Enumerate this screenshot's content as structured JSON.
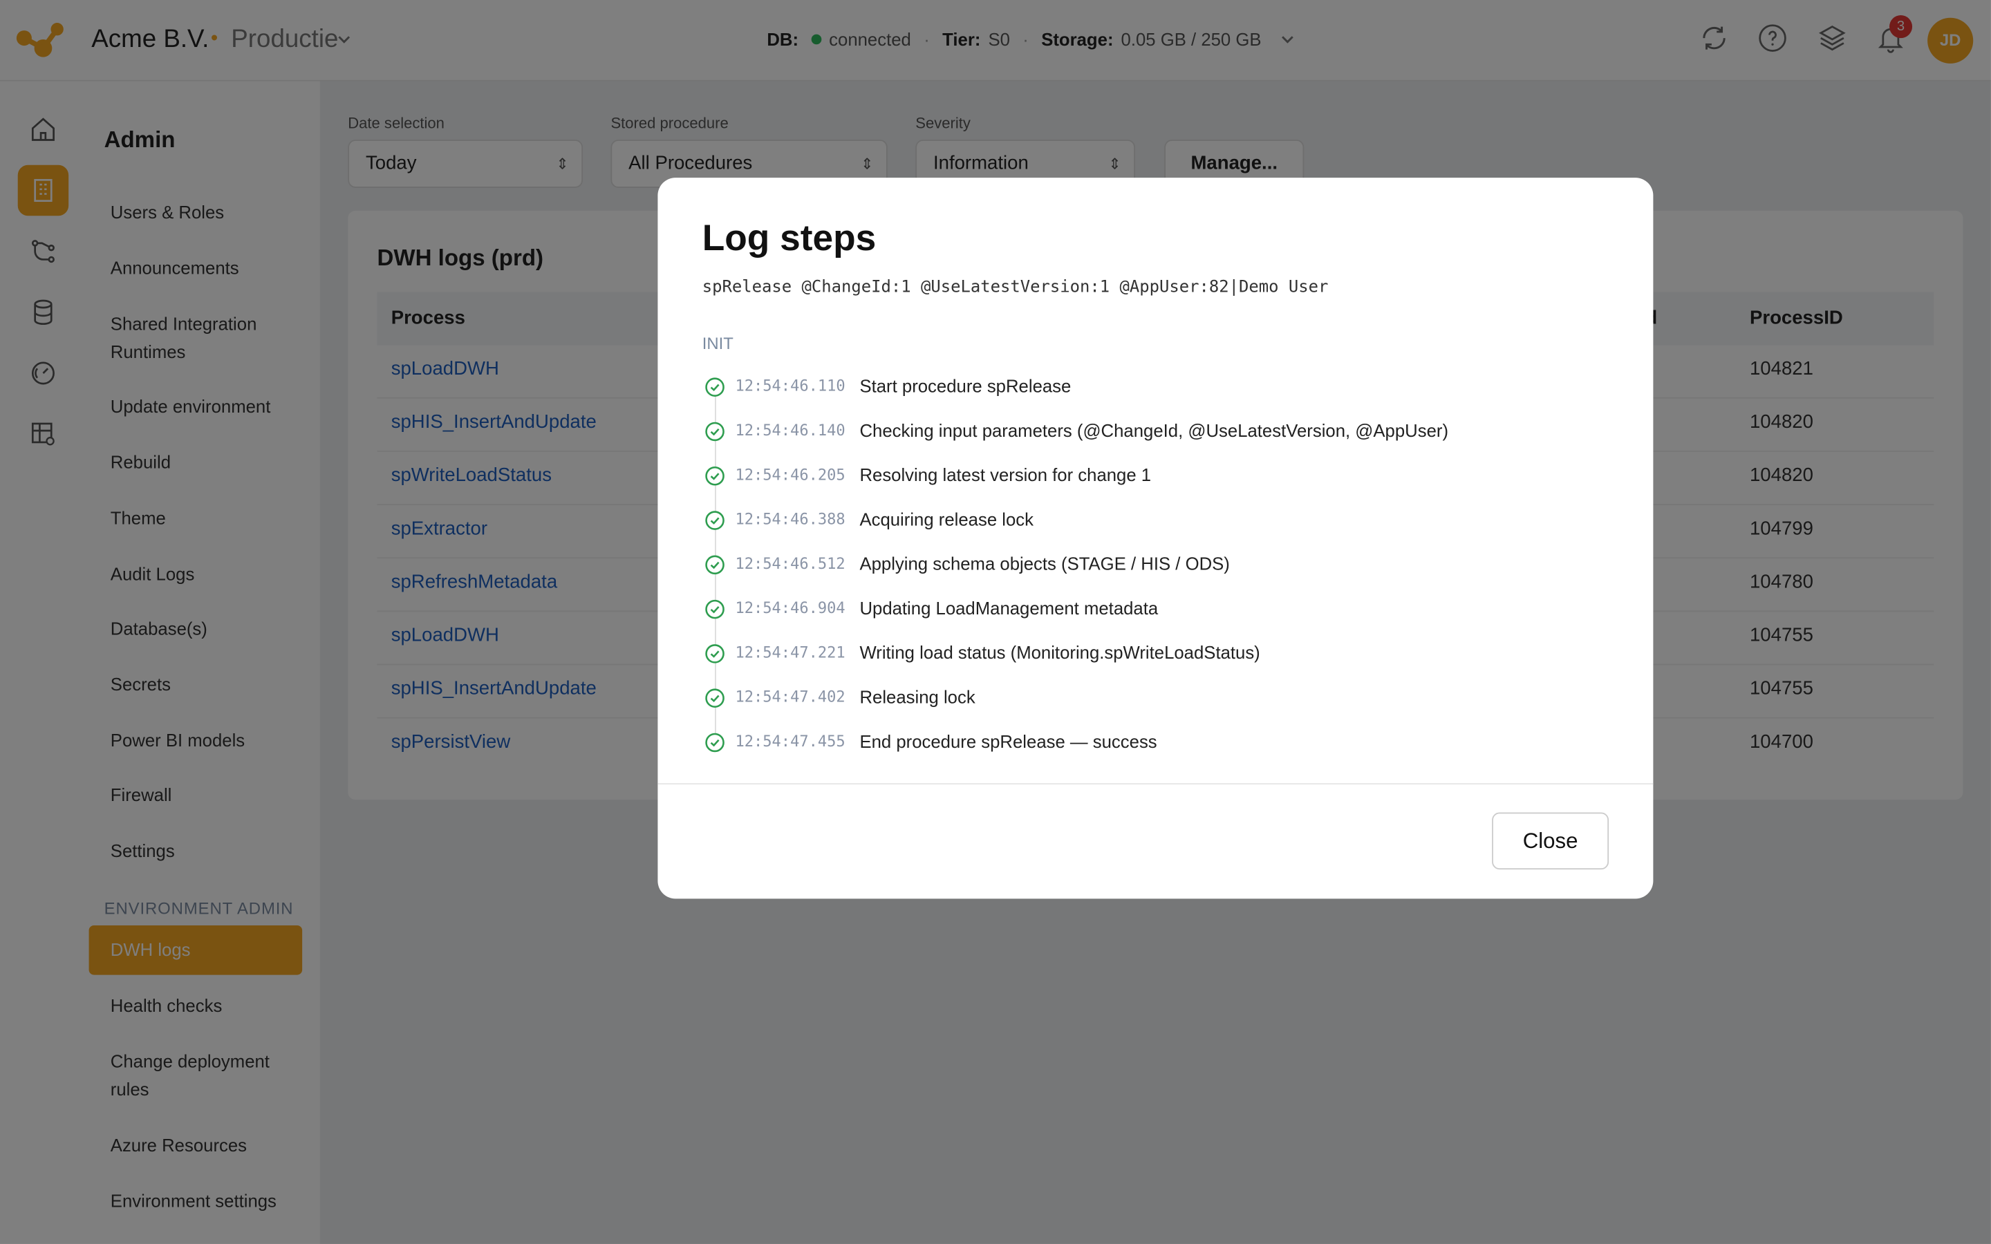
{
  "header": {
    "company": "Acme B.V.",
    "environment": "Productie",
    "db_label": "DB:",
    "db_value": "connected",
    "tier_label": "Tier:",
    "tier_value": "S0",
    "storage_label": "Storage:",
    "storage_value": "0.05 GB / 250 GB",
    "notifications_count": "3",
    "user_initials": "JD",
    "accent_color": "#f5a623"
  },
  "sidebar": {
    "title": "Admin",
    "items": [
      "Users & Roles",
      "Announcements",
      "Shared Integration Runtimes",
      "Update environment",
      "Rebuild",
      "Theme",
      "Audit Logs",
      "Database(s)",
      "Secrets",
      "Power BI models",
      "Firewall",
      "Settings"
    ],
    "section_label": "ENVIRONMENT ADMIN",
    "section_items": [
      "DWH logs",
      "Health checks",
      "Change deployment rules",
      "Azure Resources",
      "Environment settings"
    ],
    "active_item": "DWH logs"
  },
  "filters": {
    "date_label": "Date selection",
    "date_value": "Today",
    "proc_label": "Stored procedure",
    "proc_value": "All Procedures",
    "severity_label": "Severity",
    "severity_value": "Information",
    "manage_label": "Manage..."
  },
  "logs": {
    "title": "DWH logs (prd)",
    "col_process": "Process",
    "col_partial": "d",
    "col_pid": "ProcessID",
    "rows": [
      {
        "process": "spLoadDWH",
        "pid": "104821"
      },
      {
        "process": "spHIS_InsertAndUpdate",
        "pid": "104820"
      },
      {
        "process": "spWriteLoadStatus",
        "pid": "104820"
      },
      {
        "process": "spExtractor",
        "pid": "104799"
      },
      {
        "process": "spRefreshMetadata",
        "pid": "104780"
      },
      {
        "process": "spLoadDWH",
        "pid": "104755"
      },
      {
        "process": "spHIS_InsertAndUpdate",
        "pid": "104755"
      },
      {
        "process": "spPersistView",
        "pid": "104700"
      }
    ]
  },
  "modal": {
    "title": "Log steps",
    "command": "spRelease @ChangeId:1 @UseLatestVersion:1 @AppUser:82|Demo User",
    "section": "INIT",
    "steps": [
      {
        "ts": "12:54:46.110",
        "text": "Start procedure spRelease"
      },
      {
        "ts": "12:54:46.140",
        "text": "Checking input parameters (@ChangeId, @UseLatestVersion, @AppUser)"
      },
      {
        "ts": "12:54:46.205",
        "text": "Resolving latest version for change 1"
      },
      {
        "ts": "12:54:46.388",
        "text": "Acquiring release lock"
      },
      {
        "ts": "12:54:46.512",
        "text": "Applying schema objects (STAGE / HIS / ODS)"
      },
      {
        "ts": "12:54:46.904",
        "text": "Updating LoadManagement metadata"
      },
      {
        "ts": "12:54:47.221",
        "text": "Writing load status (Monitoring.spWriteLoadStatus)"
      },
      {
        "ts": "12:54:47.402",
        "text": "Releasing lock"
      },
      {
        "ts": "12:54:47.455",
        "text": "End procedure spRelease — success"
      }
    ],
    "close_label": "Close"
  }
}
